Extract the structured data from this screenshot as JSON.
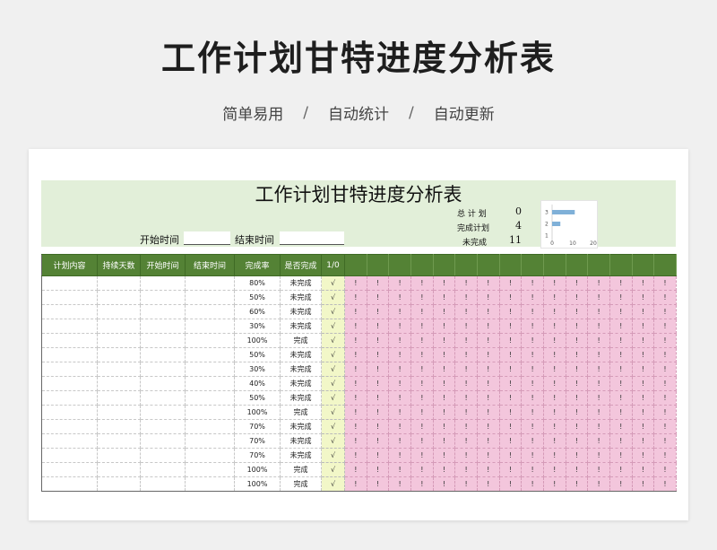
{
  "page": {
    "title": "工作计划甘特进度分析表",
    "tagline": [
      "简单易用",
      "自动统计",
      "自动更新"
    ],
    "separator": "/"
  },
  "sheet": {
    "title": "工作计划甘特进度分析表",
    "start_label": "开始时间",
    "end_label": "结束时间",
    "stats": [
      {
        "label": "总 计 划",
        "value": "0"
      },
      {
        "label": "完成计划",
        "value": "4"
      },
      {
        "label": "未完成",
        "value": "11"
      }
    ],
    "mini_chart": {
      "type": "bar",
      "categories": [
        "3",
        "2",
        "1"
      ],
      "values": [
        11,
        4,
        0
      ],
      "x_ticks": [
        "0",
        "10",
        "20"
      ],
      "xlim": [
        0,
        20
      ],
      "bar_color": "#7fb0d8"
    },
    "columns": [
      "计划内容",
      "持续天数",
      "开始时间",
      "结束时间",
      "完成率",
      "是否完成",
      "1/0"
    ],
    "gantt_cols": 15,
    "gantt_mark": "!",
    "check_mark": "√",
    "rows": [
      {
        "rate": "80%",
        "done": "未完成"
      },
      {
        "rate": "50%",
        "done": "未完成"
      },
      {
        "rate": "60%",
        "done": "未完成"
      },
      {
        "rate": "30%",
        "done": "未完成"
      },
      {
        "rate": "100%",
        "done": "完成"
      },
      {
        "rate": "50%",
        "done": "未完成"
      },
      {
        "rate": "30%",
        "done": "未完成"
      },
      {
        "rate": "40%",
        "done": "未完成"
      },
      {
        "rate": "50%",
        "done": "未完成"
      },
      {
        "rate": "100%",
        "done": "完成"
      },
      {
        "rate": "70%",
        "done": "未完成"
      },
      {
        "rate": "70%",
        "done": "未完成"
      },
      {
        "rate": "70%",
        "done": "未完成"
      },
      {
        "rate": "100%",
        "done": "完成"
      },
      {
        "rate": "100%",
        "done": "完成"
      }
    ]
  },
  "colors": {
    "header_green": "#548235",
    "band_green": "#e2efd9",
    "gantt_pink": "#f3c6dc",
    "check_yellow": "#f2f7c8"
  }
}
